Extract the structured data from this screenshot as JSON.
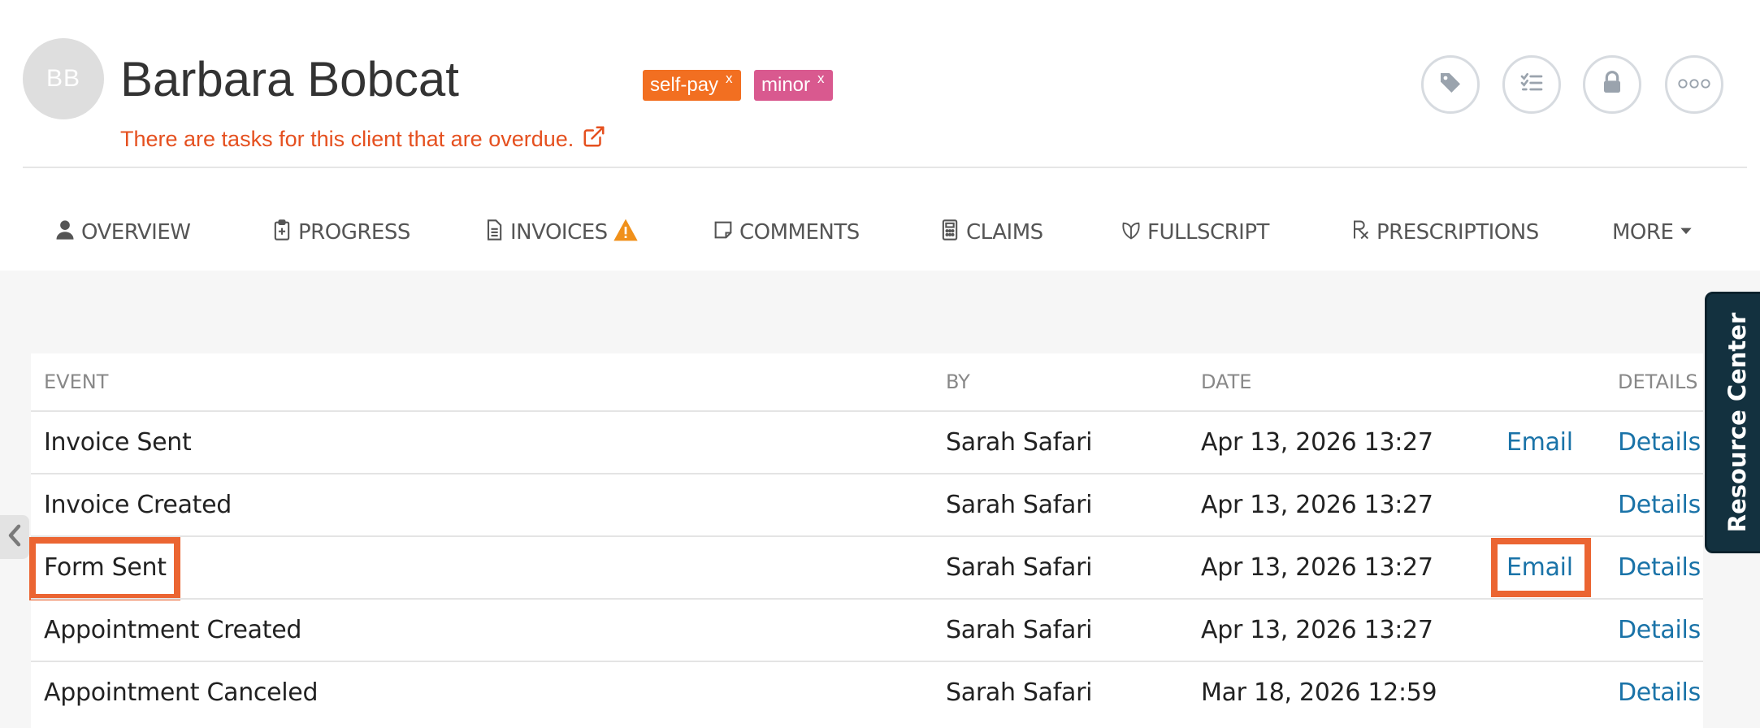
{
  "client": {
    "initials": "BB",
    "name": "Barbara Bobcat",
    "overdue_notice": "There are tasks for this client that are overdue.",
    "tags": [
      {
        "label": "self-pay",
        "remove": "x",
        "color": "#f26f21"
      },
      {
        "label": "minor",
        "remove": "x",
        "color": "#d9598f"
      }
    ]
  },
  "header_actions": {
    "tag_icon": "tag-icon",
    "tasks_icon": "checklist-icon",
    "lock_icon": "lock-icon",
    "more_icon": "ellipsis-icon"
  },
  "tabs": [
    {
      "label": "OVERVIEW",
      "icon": "user-icon"
    },
    {
      "label": "PROGRESS",
      "icon": "clipboard-plus-icon"
    },
    {
      "label": "INVOICES",
      "icon": "document-icon",
      "badge_icon": "warning-icon"
    },
    {
      "label": "COMMENTS",
      "icon": "note-icon"
    },
    {
      "label": "CLAIMS",
      "icon": "calculator-icon"
    },
    {
      "label": "FULLSCRIPT",
      "icon": "leaf-icon"
    },
    {
      "label": "PRESCRIPTIONS",
      "icon": "rx-icon"
    },
    {
      "label": "MORE",
      "icon": "caret-down-icon"
    }
  ],
  "table": {
    "columns": {
      "event": "EVENT",
      "by": "BY",
      "date": "DATE",
      "details": "DETAILS"
    },
    "rows": [
      {
        "event": "Invoice Sent",
        "by": "Sarah Safari",
        "date": "Apr 13, 2026 13:27",
        "email": "Email",
        "details": "Details"
      },
      {
        "event": "Invoice Created",
        "by": "Sarah Safari",
        "date": "Apr 13, 2026 13:27",
        "email": "",
        "details": "Details"
      },
      {
        "event": "Form Sent",
        "by": "Sarah Safari",
        "date": "Apr 13, 2026 13:27",
        "email": "Email",
        "details": "Details"
      },
      {
        "event": "Appointment Created",
        "by": "Sarah Safari",
        "date": "Apr 13, 2026 13:27",
        "email": "",
        "details": "Details"
      },
      {
        "event": "Appointment Canceled",
        "by": "Sarah Safari",
        "date": "Mar 18, 2026 12:59",
        "email": "",
        "details": "Details"
      }
    ]
  },
  "resource_center": {
    "label": "Resource Center"
  },
  "colors": {
    "accent_orange": "#e5501f",
    "highlight": "#eb6532",
    "link": "#1a73a8",
    "resource_center_bg": "#13313f"
  }
}
